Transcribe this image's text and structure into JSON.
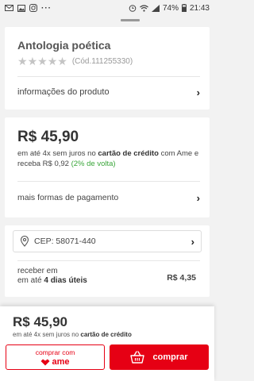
{
  "status_bar": {
    "left_icons": [
      "mail-icon",
      "image-icon",
      "instagram-icon",
      "more-dots-icon"
    ],
    "right_icons": [
      "alarm-icon",
      "wifi-icon",
      "signal-icon"
    ],
    "battery": "74%",
    "time": "21:43"
  },
  "product": {
    "title": "Antologia poética",
    "rating_stars": 5,
    "rating_filled": 0,
    "code": "(Cód.111255330)",
    "info_link": "informações do produto"
  },
  "price": {
    "main": "R$ 45,90",
    "desc_1": "em até 4x sem juros no ",
    "desc_bold": "cartão de crédito",
    "desc_2": " com Ame e receba R$ 0,92 ",
    "cashback": "(2% de volta)",
    "payment_link": "mais formas de pagamento"
  },
  "shipping": {
    "cep": "CEP: 58071-440",
    "receive_1": "receber em",
    "receive_2": "em até ",
    "receive_bold": "4 dias úteis",
    "price": "R$ 4,35"
  },
  "bottom": {
    "price": "R$ 45,90",
    "sub_1": "em até 4x sem juros no ",
    "sub_bold": "cartão de crédito",
    "ame_label": "comprar com",
    "ame_brand": "ame",
    "buy_label": "comprar"
  },
  "colors": {
    "brand_red": "#e60014",
    "cashback_green": "#3aa63a",
    "star_gray": "#c4c4c4"
  }
}
